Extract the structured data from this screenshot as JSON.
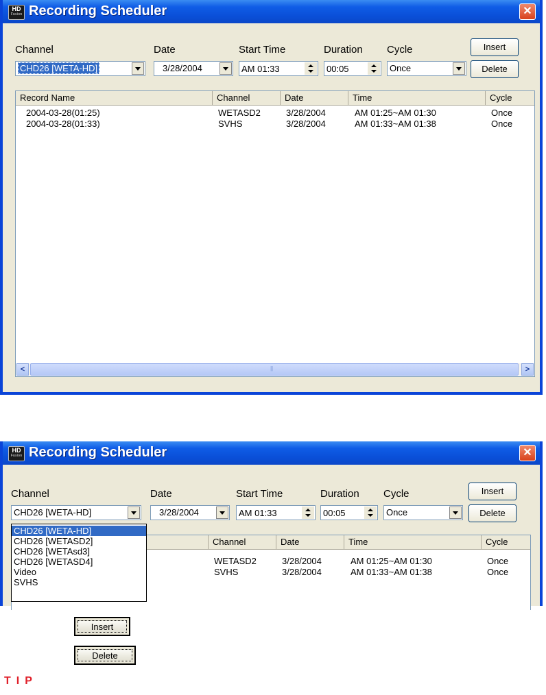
{
  "window1": {
    "title": "Recording Scheduler",
    "app_icon_text": "HD",
    "app_icon_sub": "Fusion",
    "close_glyph": "✕",
    "labels": {
      "channel": "Channel",
      "date": "Date",
      "start_time": "Start Time",
      "duration": "Duration",
      "cycle": "Cycle"
    },
    "channel_value": "CHD26 [WETA-HD]",
    "date_value": "3/28/2004",
    "start_time_value": "AM 01:33",
    "duration_value": "00:05",
    "cycle_value": "Once",
    "insert_label": "Insert",
    "delete_label": "Delete",
    "columns": [
      "Record Name",
      "Channel",
      "Date",
      "Time",
      "Cycle"
    ],
    "rows": [
      [
        "2004-03-28(01:25)",
        "WETASD2",
        "3/28/2004",
        "AM 01:25~AM 01:30",
        "Once"
      ],
      [
        "2004-03-28(01:33)",
        "SVHS",
        "3/28/2004",
        "AM 01:33~AM 01:38",
        "Once"
      ]
    ],
    "scroll_left": "<",
    "scroll_right": ">"
  },
  "window2": {
    "title": "Recording Scheduler",
    "app_icon_text": "HD",
    "app_icon_sub": "Fusion",
    "close_glyph": "✕",
    "labels": {
      "channel": "Channel",
      "date": "Date",
      "start_time": "Start Time",
      "duration": "Duration",
      "cycle": "Cycle"
    },
    "channel_value": "CHD26 [WETA-HD]",
    "date_value": "3/28/2004",
    "start_time_value": "AM 01:33",
    "duration_value": "00:05",
    "cycle_value": "Once",
    "insert_label": "Insert",
    "delete_label": "Delete",
    "columns": [
      "Channel",
      "Date",
      "Time",
      "Cycle"
    ],
    "rows": [
      [
        "WETASD2",
        "3/28/2004",
        "AM 01:25~AM 01:30",
        "Once"
      ],
      [
        "SVHS",
        "3/28/2004",
        "AM 01:33~AM 01:38",
        "Once"
      ]
    ],
    "channel_options": [
      "CHD26 [WETA-HD]",
      "CHD26 [WETASD2]",
      "CHD26 [WETAsd3]",
      "CHD26 [WETASD4]",
      "Video",
      "SVHS"
    ]
  },
  "standalone_buttons": {
    "insert": "Insert",
    "delete": "Delete"
  },
  "tip_label": "TIP"
}
